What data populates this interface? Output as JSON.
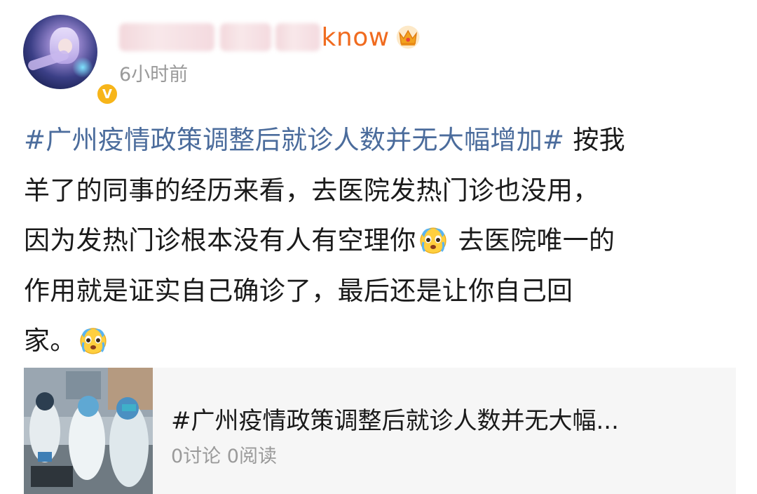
{
  "user": {
    "name_visible_tail": "know",
    "time": "6小时前",
    "verified_badge": "V",
    "avatar_icon": "anime-girl-avatar",
    "crown_icon": "crown-icon"
  },
  "post": {
    "hashtag": "#广州疫情政策调整后就诊人数并无大幅增加#",
    "line1_rest": " 按我",
    "line2": "羊了的同事的经历来看，去医院发热门诊也没用，",
    "line3_a": "因为发热门诊根本没有人有空理你",
    "line3_b": " 去医院唯一的",
    "line4": "作用就是证实自己确诊了，最后还是让你自己回",
    "line5": "家。",
    "emoji_name": "crying-face-emoji"
  },
  "topic_card": {
    "title": "#广州疫情政策调整后就诊人数并无大幅...",
    "stats": "0讨论 0阅读"
  },
  "colors": {
    "hashtag": "#4b6c9c",
    "username": "#f06b1f",
    "verify_badge": "#f7b51a",
    "meta_text": "#9a9a9a"
  }
}
